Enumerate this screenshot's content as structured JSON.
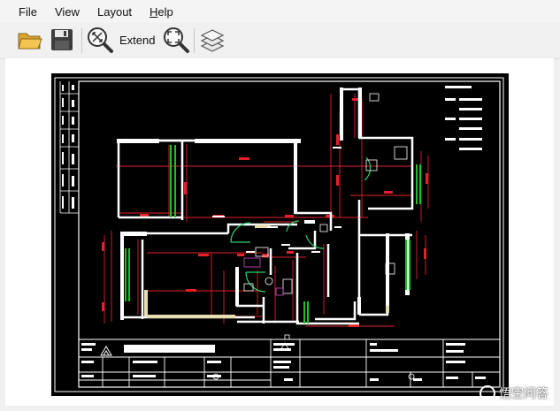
{
  "menu": {
    "file": "File",
    "view": "View",
    "layout": "Layout",
    "help": "Help"
  },
  "toolbar": {
    "extend_label": "Extend",
    "icons": [
      "open-folder-icon",
      "save-disk-icon",
      "zoom-window-icon",
      "zoom-extents-icon",
      "layers-icon"
    ]
  },
  "colors": {
    "cad_background": "#000000",
    "wall": "#ffffff",
    "dimension": "#e5202a",
    "window": "#18c22a",
    "door": "#2bd06a",
    "frame": "#ffffff"
  },
  "watermark": {
    "text": "悟空问答"
  }
}
